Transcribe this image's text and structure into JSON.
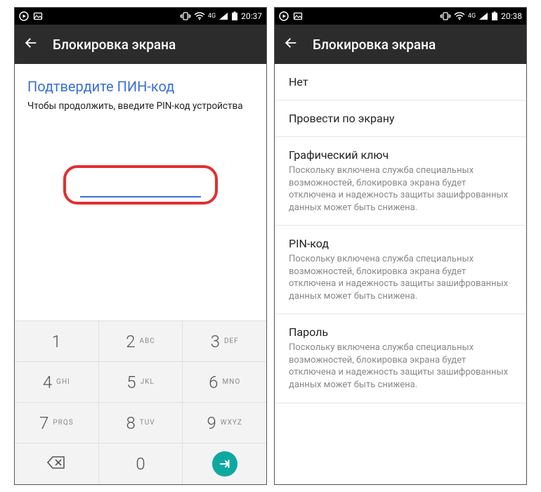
{
  "left": {
    "statusTime": "20:37",
    "net": "4G",
    "appTitle": "Блокировка экрана",
    "confirmTitle": "Подтвердите ПИН-код",
    "confirmSubtitle": "Чтобы продолжить, введите PIN-код устройства",
    "keypad": {
      "k1": "1",
      "k2": "2",
      "l2": "ABC",
      "k3": "3",
      "l3": "DEF",
      "k4": "4",
      "l4": "GHI",
      "k5": "5",
      "l5": "JKL",
      "k6": "6",
      "l6": "MNO",
      "k7": "7",
      "l7": "PRQS",
      "k8": "8",
      "l8": "TUV",
      "k9": "9",
      "l9": "WXYZ",
      "k0": "0"
    }
  },
  "right": {
    "statusTime": "20:38",
    "net": "4G",
    "appTitle": "Блокировка экрана",
    "options": {
      "none": {
        "label": "Нет"
      },
      "swipe": {
        "label": "Провести по экрану"
      },
      "pattern": {
        "label": "Графический ключ",
        "desc": "Поскольку включена служба специальных возможностей, блокировка экрана будет отключена и надежность защиты зашифрованных данных может быть снижена."
      },
      "pin": {
        "label": "PIN-код",
        "desc": "Поскольку включена служба специальных возможностей, блокировка экрана будет отключена и надежность защиты зашифрованных данных может быть снижена."
      },
      "password": {
        "label": "Пароль",
        "desc": "Поскольку включена служба специальных возможностей, блокировка экрана будет отключена и надежность защиты зашифрованных данных может быть снижена."
      }
    }
  }
}
